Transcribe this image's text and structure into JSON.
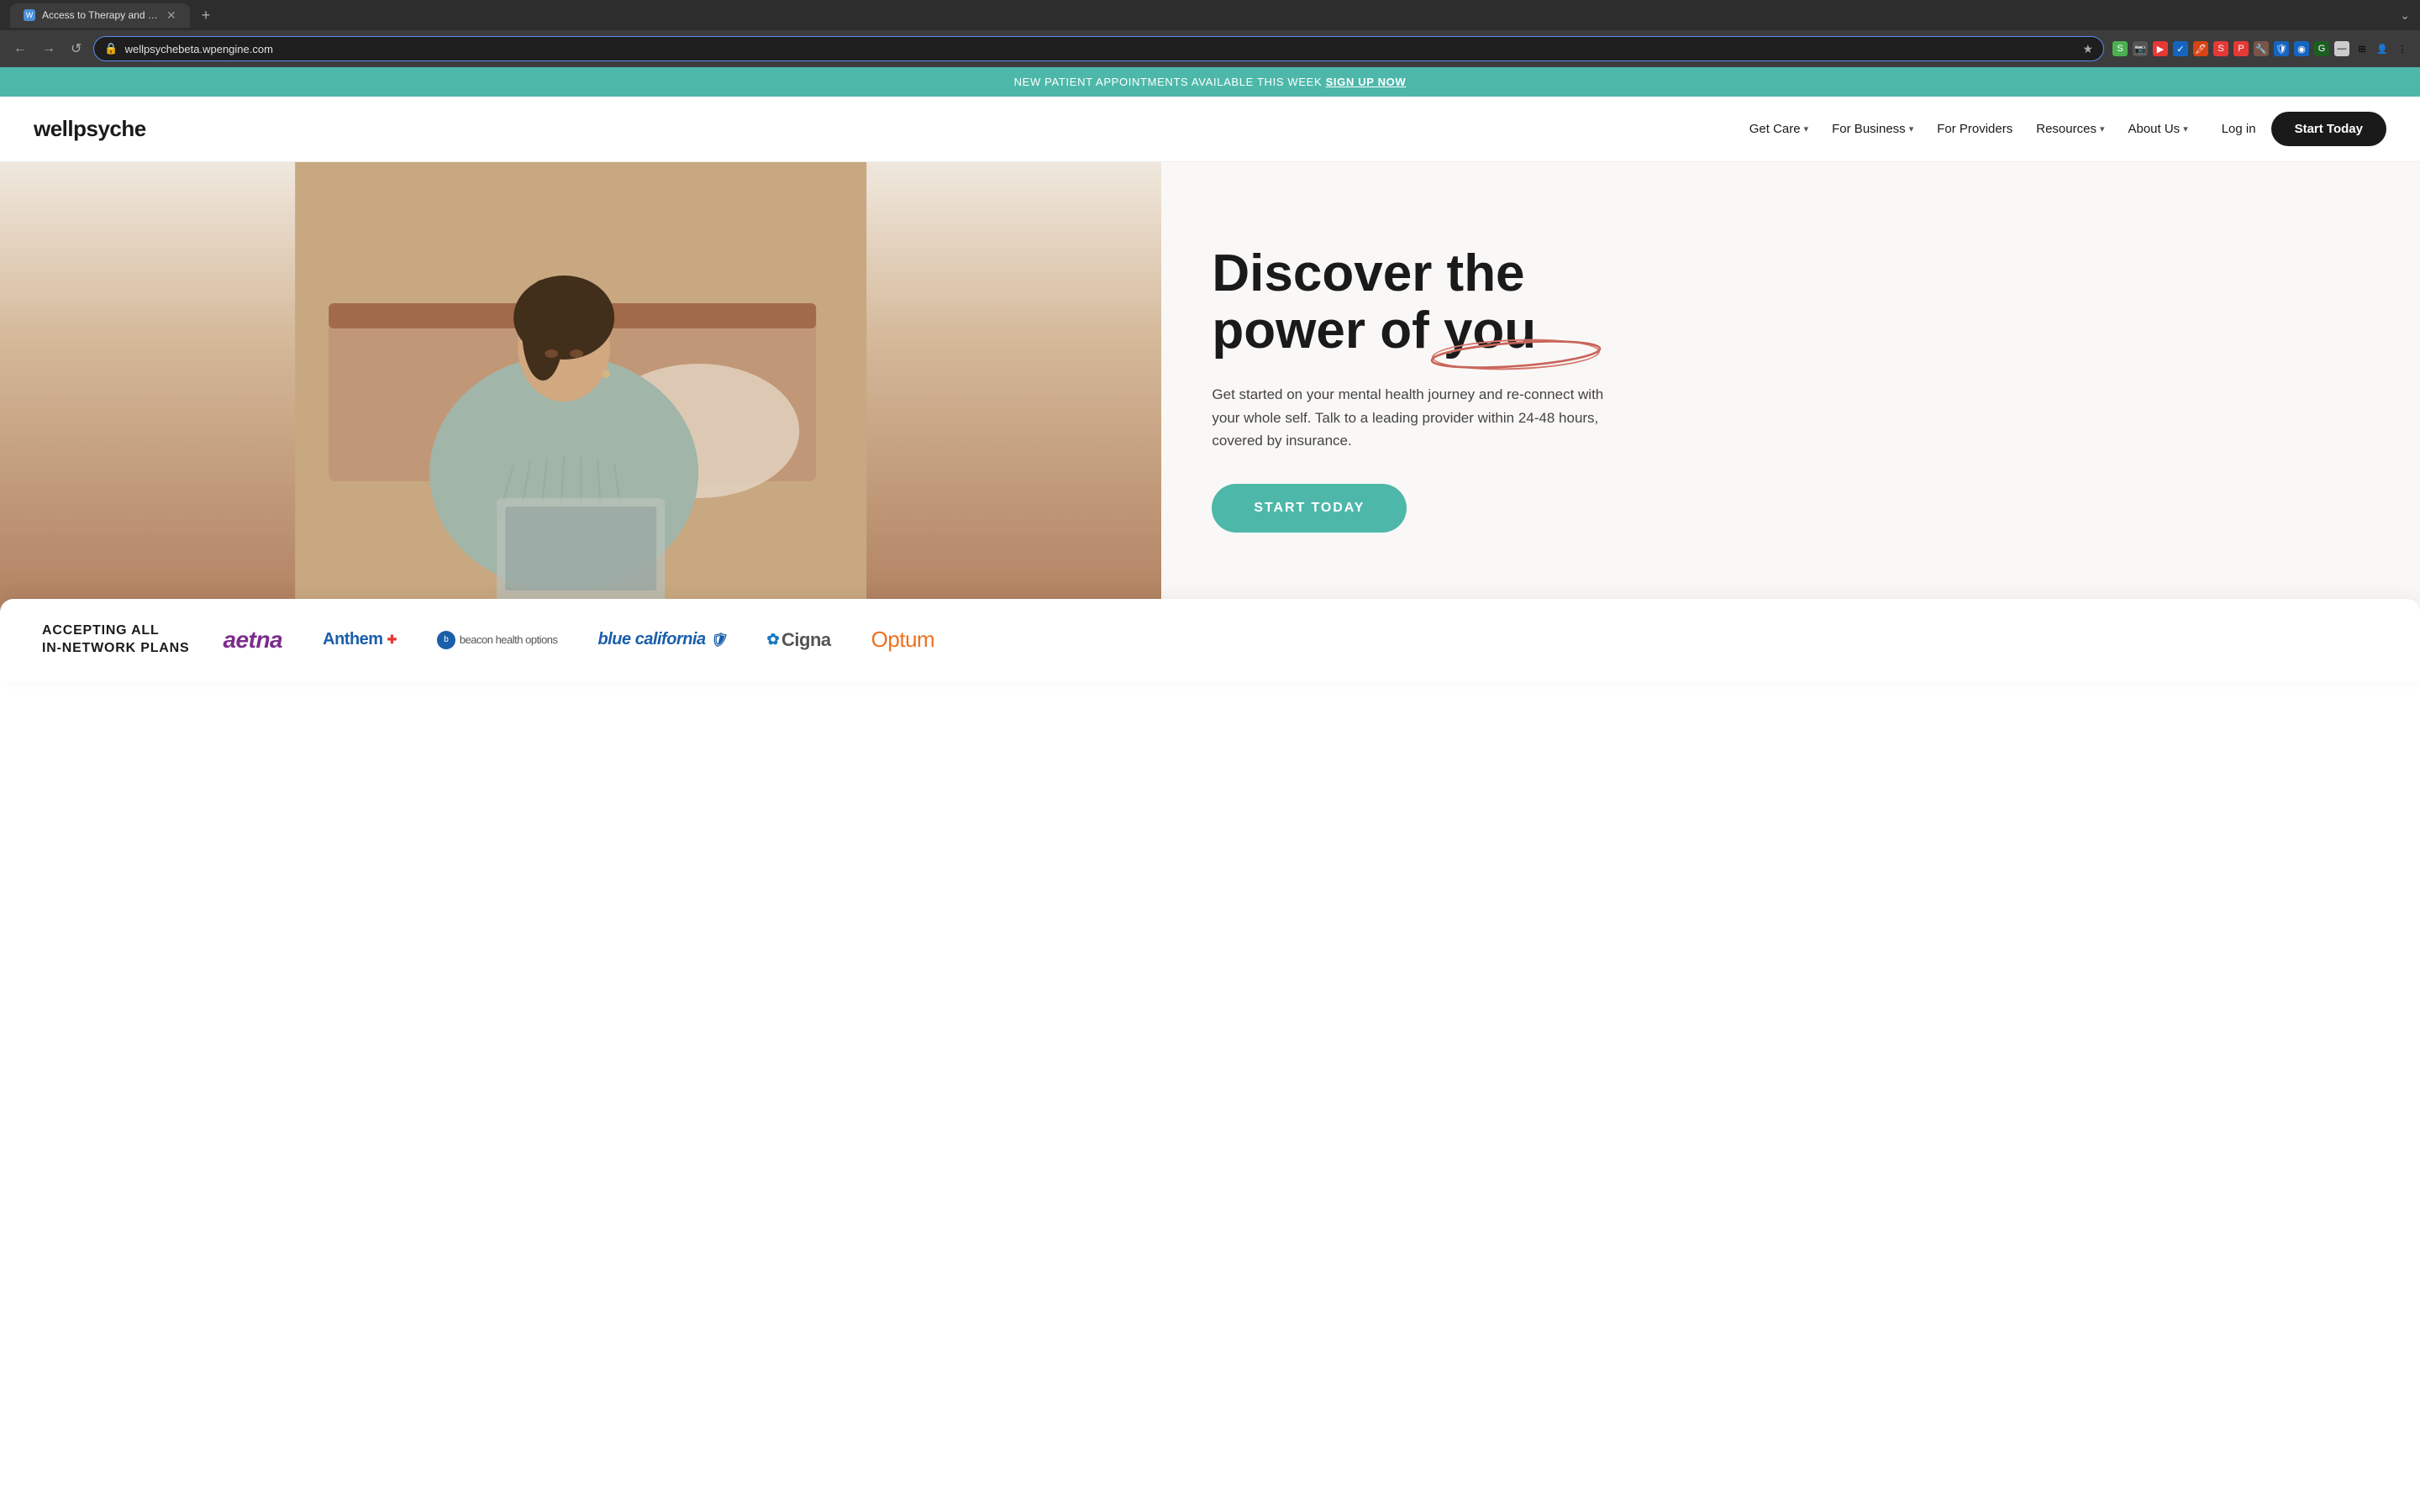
{
  "browser": {
    "tab_title": "Access to Therapy and Psych...",
    "tab_favicon": "W",
    "new_tab_label": "+",
    "url": "wellpsychebeta.wpengine.com",
    "nav_back": "←",
    "nav_forward": "→",
    "nav_refresh": "↺",
    "extension_icons": [
      "S",
      "📷",
      "▶",
      "✓",
      "🖊",
      "S",
      "P",
      "🔧",
      "🛡",
      "◉",
      "G",
      "—",
      "⊞",
      "👤",
      "⋮"
    ]
  },
  "banner": {
    "text": "NEW PATIENT APPOINTMENTS AVAILABLE THIS WEEK",
    "link_text": "SIGN UP NOW"
  },
  "nav": {
    "logo": "wellpsyche",
    "links": [
      {
        "label": "Get Care",
        "has_dropdown": true
      },
      {
        "label": "For Business",
        "has_dropdown": true
      },
      {
        "label": "For Providers",
        "has_dropdown": false
      },
      {
        "label": "Resources",
        "has_dropdown": true
      },
      {
        "label": "About Us",
        "has_dropdown": true
      }
    ],
    "login_label": "Log in",
    "cta_label": "Start Today"
  },
  "hero": {
    "title_line1": "Discover the",
    "title_line2": "power of",
    "title_highlight": "you",
    "description": "Get started on your mental health journey and re-connect with your whole self. Talk to a leading provider within 24-48 hours, covered by insurance.",
    "cta_label": "START TODAY"
  },
  "insurance": {
    "heading_line1": "ACCEPTING ALL",
    "heading_line2": "IN-NETWORK PLANS",
    "logos": [
      {
        "name": "aetna",
        "display": "aetna"
      },
      {
        "name": "anthem",
        "display": "Anthem"
      },
      {
        "name": "beacon",
        "display": "beacon health options"
      },
      {
        "name": "blue_california",
        "display": "blue california"
      },
      {
        "name": "cigna",
        "display": "Cigna"
      },
      {
        "name": "optum",
        "display": "Optum"
      }
    ]
  }
}
